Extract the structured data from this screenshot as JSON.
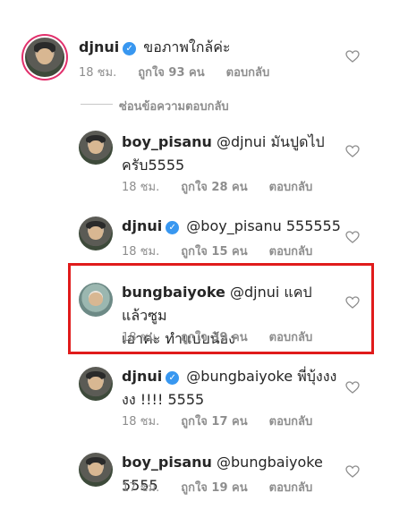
{
  "comments": [
    {
      "username": "djnui",
      "verified": true,
      "mention": "",
      "text": "ขอภาพใกล้ค่ะ",
      "time": "18 ชม.",
      "likes": "ถูกใจ 93 คน",
      "reply": "ตอบกลับ"
    },
    {
      "username": "boy_pisanu",
      "verified": false,
      "mention": "@djnui",
      "text": "มันปูดไป",
      "text2": "ครับ5555",
      "time": "18 ชม.",
      "likes": "ถูกใจ 28 คน",
      "reply": "ตอบกลับ"
    },
    {
      "username": "djnui",
      "verified": true,
      "mention": "@boy_pisanu",
      "text": "555555",
      "time": "18 ชม.",
      "likes": "ถูกใจ 15 คน",
      "reply": "ตอบกลับ"
    },
    {
      "username": "bungbaiyoke",
      "verified": false,
      "mention": "@djnui",
      "text": "แคปแล้วซูม",
      "text2": "เอาค่ะ ทำแบบน้อง",
      "time": "18 ชม.",
      "likes": "ถูกใจ 39 คน",
      "reply": "ตอบกลับ"
    },
    {
      "username": "djnui",
      "verified": true,
      "mention": "@bungbaiyoke",
      "text": "พี่บุ้งงง",
      "text2": "งง !!!! 5555",
      "time": "18 ชม.",
      "likes": "ถูกใจ 17 คน",
      "reply": "ตอบกลับ"
    },
    {
      "username": "boy_pisanu",
      "verified": false,
      "mention": "@bungbaiyoke",
      "text": "5555",
      "time": "17 ชม.",
      "likes": "ถูกใจ 19 คน",
      "reply": "ตอบกลับ"
    }
  ],
  "hide_replies": "ซ่อนข้อความตอบกลับ",
  "colors": {
    "highlight": "#e01b1b",
    "verified": "#3897f0",
    "muted": "#8e8e8e"
  },
  "icons": {
    "verified": "verified-badge-icon",
    "like": "heart-icon"
  }
}
